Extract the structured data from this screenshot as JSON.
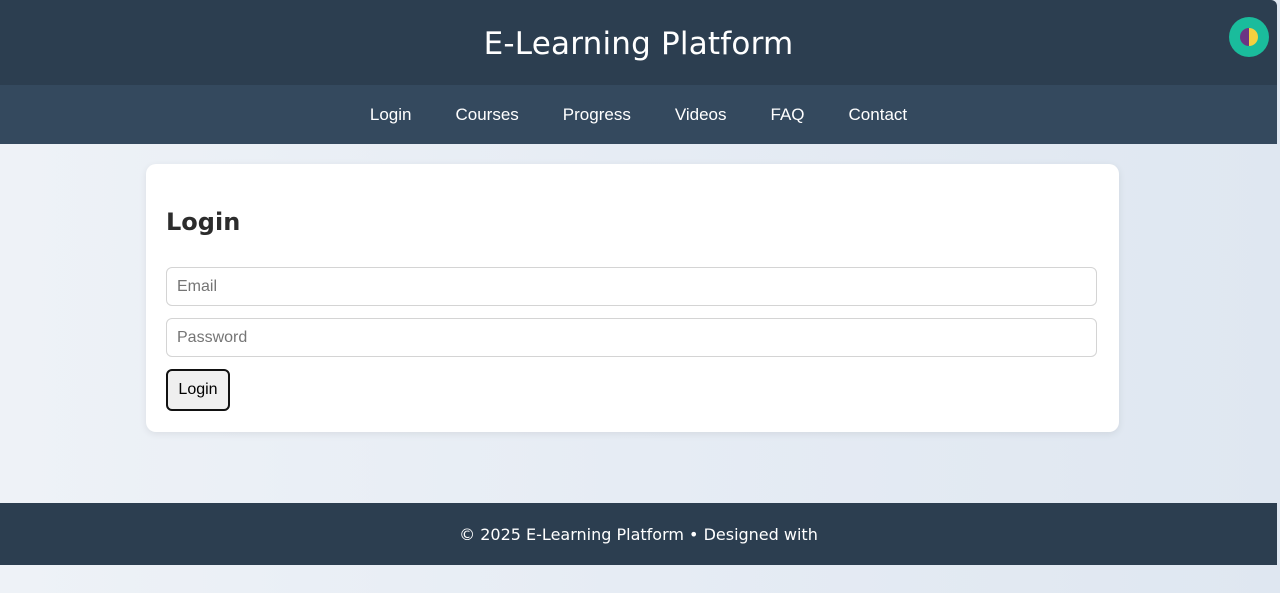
{
  "header": {
    "title": "E-Learning Platform",
    "theme_toggle_icon": "half-moon-contrast-icon",
    "accent_color": "#1abc9c"
  },
  "nav": {
    "items": [
      {
        "label": "Login"
      },
      {
        "label": "Courses"
      },
      {
        "label": "Progress"
      },
      {
        "label": "Videos"
      },
      {
        "label": "FAQ"
      },
      {
        "label": "Contact"
      }
    ]
  },
  "login": {
    "heading": "Login",
    "email_placeholder": "Email",
    "email_value": "",
    "password_placeholder": "Password",
    "password_value": "",
    "submit_label": "Login"
  },
  "footer": {
    "text": "© 2025 E-Learning Platform • Designed with"
  },
  "colors": {
    "header_bg": "#2c3e50",
    "nav_bg": "#34495e",
    "footer_bg": "#2c3e50"
  }
}
